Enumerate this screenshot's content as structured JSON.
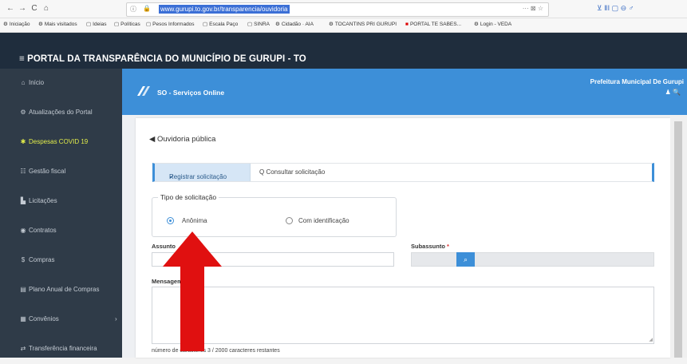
{
  "browser": {
    "url": "www.gurupi.to.gov.br/transparencia/ouvidoria",
    "nav": [
      "←",
      "→",
      "C",
      "⌂"
    ],
    "url_right": "··· ⊠ ☆",
    "toolbar_icons": "⊻ ⅡⅠ ▢ ⊖ ♂",
    "bookmarks": [
      "Iniciação",
      "Mais visitados",
      "Ideias",
      "Políticas",
      "Pesos Informados",
      "Escala Paço",
      "SINRA",
      "Cidadão · AIA",
      "TOCANTINS PRI GURUPI",
      "PORTAL TE SABES...",
      "Login - VEDA"
    ]
  },
  "portal": {
    "title": "≡ PORTAL DA TRANSPARÊNCIA DO MUNICÍPIO DE GURUPI - TO"
  },
  "sidebar": {
    "items": [
      {
        "icon": "⌂",
        "label": "Início"
      },
      {
        "icon": "⚙",
        "label": "Atualizações do Portal"
      },
      {
        "icon": "✱",
        "label": "Despesas COVID 19"
      },
      {
        "icon": "☷",
        "label": "Gestão fiscal"
      },
      {
        "icon": "▙",
        "label": "Licitações"
      },
      {
        "icon": "◉",
        "label": "Contratos"
      },
      {
        "icon": "$",
        "label": "Compras"
      },
      {
        "icon": "▤",
        "label": "Plano Anual de Compras"
      },
      {
        "icon": "▦",
        "label": "Convênios",
        "chevron": "›"
      },
      {
        "icon": "⇄",
        "label": "Transferência financeira"
      }
    ]
  },
  "header": {
    "so_title": "SO - Serviços Online",
    "prefeitura": "Prefeitura Municipal De Gurupi",
    "icons": "♟ 🔍"
  },
  "form": {
    "page_title": "Ouvidoria pública",
    "tab_register": "Registrar solicitação",
    "tab_consult": "Consultar solicitação",
    "tipo_legend": "Tipo de solicitação",
    "radio_anon": "Anônima",
    "radio_ident": "Com identificação",
    "assunto_label": "Assunto",
    "subassunto_label": "Subassunto",
    "required_mark": "*",
    "mensagem_label": "Mensagem",
    "counter": "número de caracteres 3 / 2000 caracteres restantes"
  },
  "colors": {
    "header_blue": "#3d8fd8",
    "arrow_red": "#e01010",
    "sidebar": "#2f3b48",
    "active": "#e2ec4a"
  }
}
